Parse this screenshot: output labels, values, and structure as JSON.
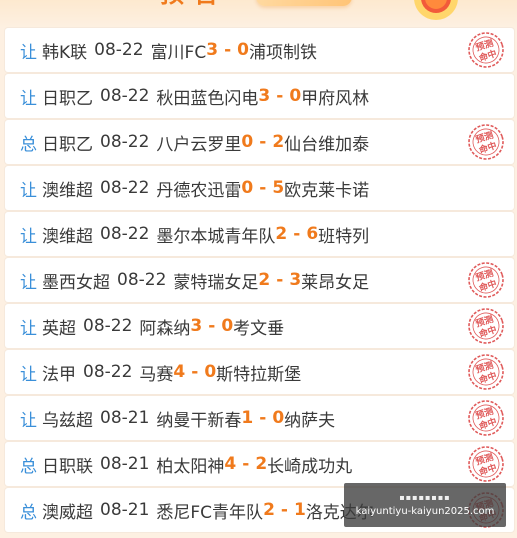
{
  "header": {
    "title": "预告"
  },
  "predictions": [
    {
      "type": "让",
      "league": "韩K联",
      "date": "08-22",
      "home": "富川FC",
      "home_score": "3",
      "sep": "-",
      "away_score": "0",
      "away": "浦项制铁",
      "hit": true
    },
    {
      "type": "让",
      "league": "日职乙",
      "date": "08-22",
      "home": "秋田蓝色闪电",
      "home_score": "3",
      "sep": "-",
      "away_score": "0",
      "away": "甲府风林",
      "hit": false
    },
    {
      "type": "总",
      "league": "日职乙",
      "date": "08-22",
      "home": "八户云罗里",
      "home_score": "0",
      "sep": "-",
      "away_score": "2",
      "away": "仙台维加泰",
      "hit": true
    },
    {
      "type": "让",
      "league": "澳维超",
      "date": "08-22",
      "home": "丹德农迅雷",
      "home_score": "0",
      "sep": "-",
      "away_score": "5",
      "away": "欧克莱卡诺",
      "hit": false
    },
    {
      "type": "让",
      "league": "澳维超",
      "date": "08-22",
      "home": "墨尔本城青年队",
      "home_score": "2",
      "sep": "-",
      "away_score": "6",
      "away": "班特列",
      "hit": false
    },
    {
      "type": "让",
      "league": "墨西女超",
      "date": "08-22",
      "home": "蒙特瑞女足",
      "home_score": "2",
      "sep": "-",
      "away_score": "3",
      "away": "莱昂女足",
      "hit": true
    },
    {
      "type": "让",
      "league": "英超",
      "date": "08-22",
      "home": "阿森纳",
      "home_score": "3",
      "sep": "-",
      "away_score": "0",
      "away": "考文垂",
      "hit": true
    },
    {
      "type": "让",
      "league": "法甲",
      "date": "08-22",
      "home": "马赛",
      "home_score": "4",
      "sep": "-",
      "away_score": "0",
      "away": "斯特拉斯堡",
      "hit": true
    },
    {
      "type": "让",
      "league": "乌兹超",
      "date": "08-21",
      "home": "纳曼干新春",
      "home_score": "1",
      "sep": "-",
      "away_score": "0",
      "away": "纳萨夫",
      "hit": true
    },
    {
      "type": "总",
      "league": "日职联",
      "date": "08-21",
      "home": "柏太阳神",
      "home_score": "4",
      "sep": "-",
      "away_score": "2",
      "away": "长崎成功丸",
      "hit": true
    },
    {
      "type": "总",
      "league": "澳威超",
      "date": "08-21",
      "home": "悉尼FC青年队",
      "home_score": "2",
      "sep": "-",
      "away_score": "1",
      "away": "洛克达尔",
      "hit": true
    }
  ],
  "stamp": {
    "line1": "预测",
    "line2": "命中"
  },
  "watermark": {
    "line1": "▪▪▪▪▪▪▪▪",
    "url": "kaiyuntiyu-kaiyun2025.com"
  },
  "colors": {
    "accent": "#f07a1c",
    "type": "#3a8fd9",
    "stamp": "#e05a5a"
  }
}
